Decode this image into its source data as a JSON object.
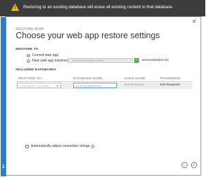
{
  "banner": {
    "text": "Restoring to an existing database will erase all existing content in that database."
  },
  "dialog": {
    "eyebrow": "RESTORE NOW",
    "title": "Choose your web app restore settings"
  },
  "restore_to": {
    "section_label": "RESTORE TO",
    "options": [
      {
        "label": "Current web app",
        "selected": true
      },
      {
        "label": "New web app instance",
        "selected": false
      }
    ],
    "instance_value": "restored-webapp-name",
    "domain_suffix": ".azurewebsites.net"
  },
  "databases": {
    "section_label": "INCLUDED DATABASES",
    "columns": [
      "RESTORE TO",
      "DATABASE NAME",
      "USER NAME",
      "PASSWORD"
    ],
    "row": {
      "restore_to_value": "existingdb01 (Locatio...",
      "database_name": "existingdatabase01",
      "user_name": "Not Required",
      "password": "Not Required"
    }
  },
  "auto_adjust": {
    "label": "Automatically adjust connection strings",
    "checked": false
  },
  "footer": {
    "step": "1"
  }
}
